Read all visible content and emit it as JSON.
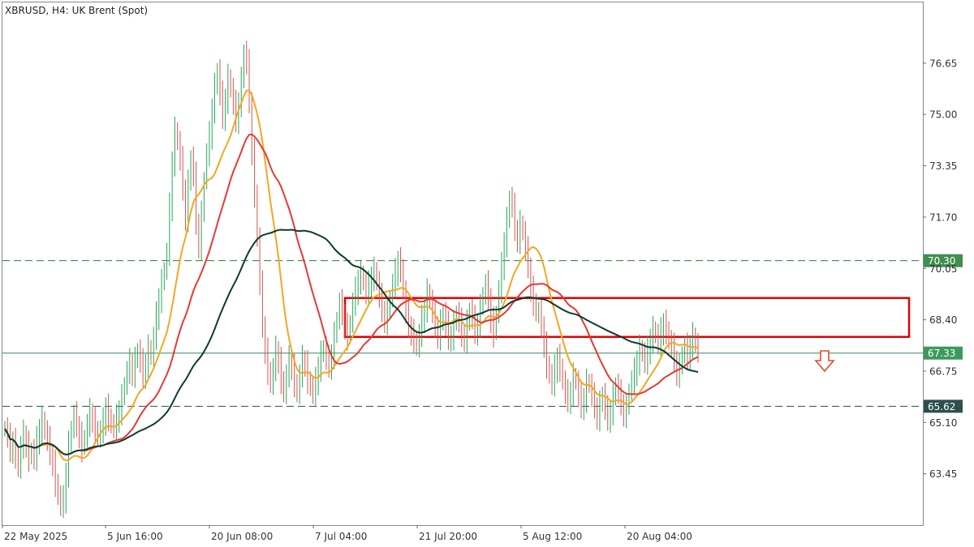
{
  "chart_data": {
    "type": "candlestick",
    "title": "XBRUSD, H4:  UK Brent (Spot)",
    "ylim": [
      61.8,
      78.6
    ],
    "y_ticks": [
      "76.65",
      "75.00",
      "73.35",
      "71.70",
      "70.05",
      "68.40",
      "66.75",
      "65.10",
      "63.45"
    ],
    "x_ticks": [
      "22 May 2025",
      "5 Jun 16:00",
      "20 Jun 08:00",
      "7 Jul 04:00",
      "21 Jul 20:00",
      "5 Aug 12:00",
      "20 Aug 04:00"
    ],
    "price_levels": [
      {
        "value": 70.3,
        "label": "70.30",
        "style": "dashed",
        "color": "#2e7d32"
      },
      {
        "value": 65.62,
        "label": "65.62",
        "style": "dashed",
        "color": "#2f4f4f"
      },
      {
        "value": 67.33,
        "label": "67.33",
        "style": "solid",
        "color": "#2e8b57"
      }
    ],
    "zone": {
      "price_top": 69.1,
      "price_bottom": 67.85,
      "color": "#e00000"
    },
    "arrow": {
      "direction": "down",
      "color": "#e04b2a"
    },
    "close": [
      64.9,
      64.6,
      64.2,
      64.5,
      64.1,
      63.6,
      64.3,
      64.7,
      64.4,
      64.0,
      64.2,
      63.9,
      64.5,
      64.9,
      65.2,
      64.8,
      64.5,
      64.1,
      63.8,
      63.2,
      62.7,
      62.4,
      62.6,
      63.5,
      64.4,
      64.9,
      65.3,
      65.0,
      64.7,
      64.3,
      64.6,
      65.0,
      65.4,
      65.2,
      64.9,
      64.6,
      64.8,
      65.1,
      65.6,
      65.3,
      65.0,
      64.9,
      65.2,
      65.5,
      65.9,
      66.3,
      66.7,
      67.0,
      66.7,
      67.1,
      67.4,
      67.0,
      66.6,
      67.0,
      67.5,
      67.2,
      67.8,
      68.5,
      69.1,
      69.6,
      70.0,
      70.5,
      72.0,
      73.5,
      74.5,
      74.1,
      73.5,
      72.6,
      71.7,
      72.8,
      73.6,
      73.0,
      71.5,
      70.8,
      71.8,
      72.9,
      73.7,
      74.3,
      75.2,
      75.9,
      76.4,
      75.6,
      74.9,
      75.5,
      76.2,
      75.8,
      75.3,
      74.8,
      75.4,
      76.1,
      77.0,
      76.6,
      75.4,
      73.8,
      72.5,
      71.0,
      69.5,
      68.2,
      67.4,
      66.8,
      66.3,
      66.8,
      67.4,
      67.1,
      66.5,
      66.0,
      66.6,
      67.1,
      66.9,
      66.4,
      66.0,
      66.6,
      67.1,
      67.0,
      66.5,
      66.2,
      66.0,
      66.4,
      66.9,
      67.3,
      67.5,
      67.1,
      66.9,
      67.3,
      67.9,
      68.4,
      68.9,
      68.6,
      68.2,
      67.9,
      68.3,
      68.9,
      69.3,
      69.7,
      69.9,
      69.6,
      69.2,
      69.5,
      69.8,
      70.0,
      69.6,
      69.1,
      68.7,
      68.4,
      68.7,
      69.1,
      69.5,
      69.9,
      70.3,
      70.1,
      69.3,
      68.6,
      68.2,
      68.0,
      67.8,
      67.5,
      67.9,
      68.4,
      68.8,
      69.3,
      69.0,
      68.6,
      68.2,
      67.9,
      68.3,
      68.6,
      68.2,
      67.8,
      67.9,
      68.3,
      68.6,
      68.3,
      67.9,
      67.8,
      68.3,
      68.7,
      68.4,
      68.0,
      68.3,
      68.8,
      69.2,
      69.5,
      69.1,
      68.4,
      68.0,
      68.6,
      69.3,
      70.1,
      70.9,
      71.6,
      72.3,
      72.0,
      71.3,
      71.0,
      71.5,
      71.2,
      70.6,
      70.1,
      69.4,
      69.0,
      68.6,
      68.6,
      68.2,
      67.6,
      67.0,
      66.6,
      66.3,
      66.8,
      67.2,
      66.9,
      66.4,
      66.0,
      65.8,
      66.1,
      66.6,
      66.4,
      65.9,
      65.6,
      65.9,
      66.4,
      66.3,
      65.9,
      65.6,
      65.3,
      65.7,
      66.0,
      65.5,
      65.2,
      65.5,
      65.9,
      66.3,
      66.0,
      65.7,
      65.4,
      65.6,
      66.1,
      66.4,
      66.7,
      67.1,
      67.5,
      67.3,
      67.0,
      67.4,
      67.8,
      68.1,
      67.9,
      67.6,
      68.0,
      68.3,
      68.1,
      67.7,
      67.5,
      67.1,
      66.7,
      66.9,
      67.3,
      67.5,
      67.2,
      67.6,
      67.9,
      67.6,
      67.33
    ],
    "series": [
      {
        "color": "#f5a623"
      },
      {
        "color": "#e53935"
      },
      {
        "color": "#0d3b2e"
      }
    ]
  }
}
